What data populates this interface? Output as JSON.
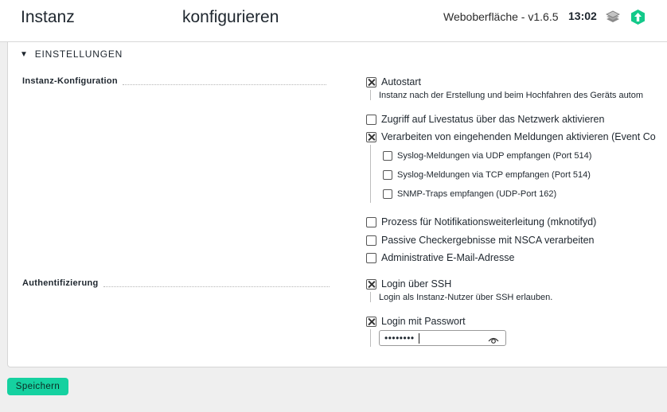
{
  "header": {
    "title_left": "Instanz",
    "title_right": "konfigurieren",
    "version": "Weboberfläche - v1.6.5",
    "time": "13:02"
  },
  "section": {
    "title": "EINSTELLUNGEN"
  },
  "instance_config": {
    "label": "Instanz-Konfiguration",
    "autostart": {
      "label": "Autostart",
      "checked": true,
      "help": "Instanz nach der Erstellung und beim Hochfahren des Geräts autom"
    },
    "livestatus": {
      "label": "Zugriff auf Livestatus über das Netzwerk aktivieren",
      "checked": false
    },
    "event_console": {
      "label": "Verarbeiten von eingehenden Meldungen aktivieren (Event Co",
      "checked": true
    },
    "syslog_udp": {
      "label": "Syslog-Meldungen via UDP empfangen (Port 514)",
      "checked": false
    },
    "syslog_tcp": {
      "label": "Syslog-Meldungen via TCP empfangen (Port 514)",
      "checked": false
    },
    "snmp_traps": {
      "label": "SNMP-Traps empfangen (UDP-Port 162)",
      "checked": false
    },
    "mknotifyd": {
      "label": "Prozess für Notifikationsweiterleitung (mknotifyd)",
      "checked": false
    },
    "nsca": {
      "label": "Passive Checkergebnisse mit NSCA verarbeiten",
      "checked": false
    },
    "admin_email": {
      "label": "Administrative E-Mail-Adresse",
      "checked": false
    }
  },
  "authentication": {
    "label": "Authentifizierung",
    "ssh": {
      "label": "Login über SSH",
      "checked": true,
      "help": "Login als Instanz-Nutzer über SSH erlauben."
    },
    "password": {
      "label": "Login mit Passwort",
      "checked": true,
      "value": "••••••••"
    }
  },
  "footer": {
    "save_label": "Speichern"
  },
  "colors": {
    "accent": "#15d1a0",
    "update_icon": "#13c98a"
  }
}
